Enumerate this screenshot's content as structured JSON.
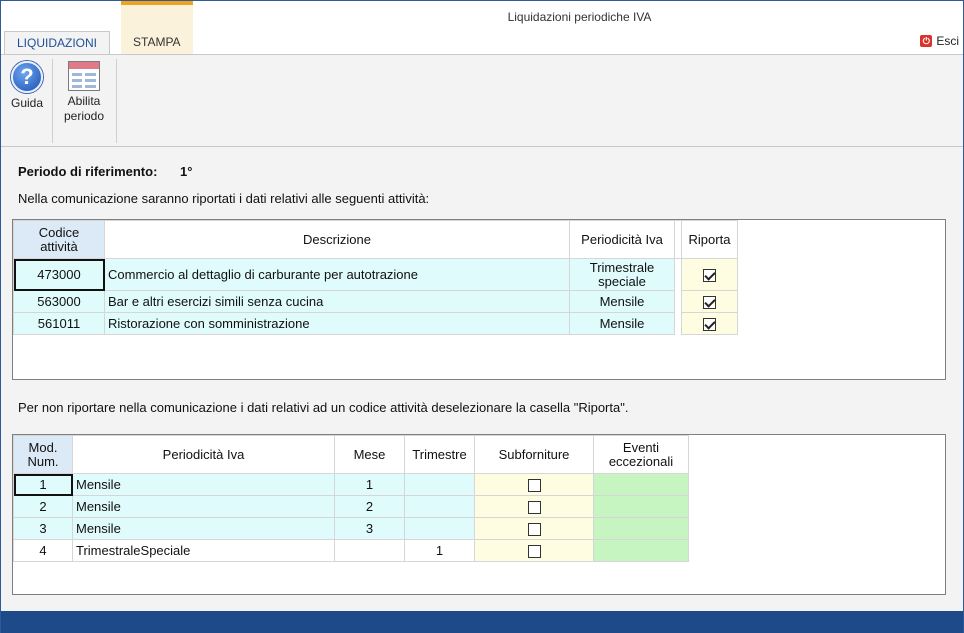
{
  "window": {
    "title": "Liquidazioni periodiche IVA"
  },
  "tabs": [
    {
      "label": "LIQUIDAZIONI"
    },
    {
      "label": "STAMPA"
    }
  ],
  "esci": {
    "label": "Esci",
    "icon": "exit-icon"
  },
  "ribbon": {
    "guida": {
      "label": "Guida",
      "icon": "help-icon"
    },
    "abilita": {
      "label_line1": "Abilita",
      "label_line2": "periodo",
      "icon": "calendar-icon"
    }
  },
  "periodo": {
    "label": "Periodo di riferimento:",
    "value": "1°"
  },
  "info1": "Nella comunicazione saranno riportati i dati relativi alle seguenti attività:",
  "info2": "Per non riportare nella comunicazione i dati relativi ad un codice attività deselezionare la casella \"Riporta\".",
  "activities": {
    "headers": {
      "codice_line1": "Codice",
      "codice_line2": "attività",
      "descrizione": "Descrizione",
      "periodicita": "Periodicità Iva",
      "riporta": "Riporta"
    },
    "rows": [
      {
        "codice": "473000",
        "descrizione": "Commercio al dettaglio di carburante per autotrazione",
        "periodicita_line1": "Trimestrale",
        "periodicita_line2": "speciale",
        "riporta": true
      },
      {
        "codice": "563000",
        "descrizione": "Bar e altri esercizi simili senza cucina",
        "periodicita_line1": "Mensile",
        "periodicita_line2": "",
        "riporta": true
      },
      {
        "codice": "561011",
        "descrizione": "Ristorazione con somministrazione",
        "periodicita_line1": "Mensile",
        "periodicita_line2": "",
        "riporta": true
      }
    ]
  },
  "modules": {
    "headers": {
      "mod_line1": "Mod.",
      "mod_line2": "Num.",
      "periodicita": "Periodicità Iva",
      "mese": "Mese",
      "trimestre": "Trimestre",
      "subforniture": "Subforniture",
      "eventi_line1": "Eventi",
      "eventi_line2": "eccezionali"
    },
    "rows": [
      {
        "num": "1",
        "periodicita": "Mensile",
        "mese": "1",
        "trimestre": "",
        "subforniture": false
      },
      {
        "num": "2",
        "periodicita": "Mensile",
        "mese": "2",
        "trimestre": "",
        "subforniture": false
      },
      {
        "num": "3",
        "periodicita": "Mensile",
        "mese": "3",
        "trimestre": "",
        "subforniture": false
      },
      {
        "num": "4",
        "periodicita": "TrimestraleSpeciale",
        "mese": "",
        "trimestre": "1",
        "subforniture": false
      }
    ]
  },
  "colors": {
    "accent": "#1f4f96",
    "cell_cyan": "#e0fbfb",
    "cell_yellow": "#fefde2",
    "cell_green": "#c6f5c2",
    "statusbar": "#1e4a8a",
    "tab_context": "#f0a31e"
  }
}
